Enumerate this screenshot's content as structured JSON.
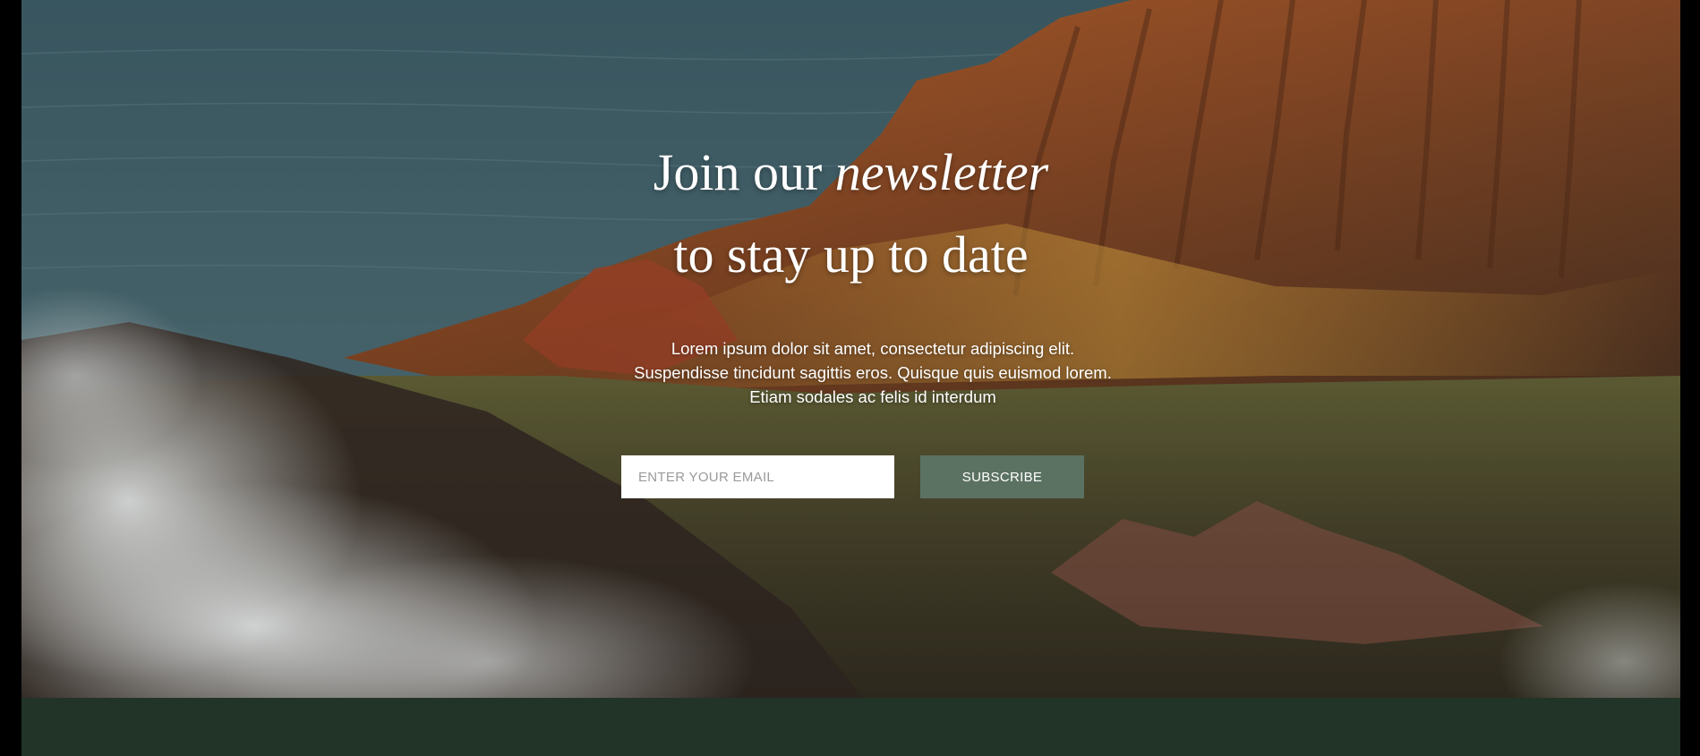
{
  "newsletter": {
    "heading_line1_prefix": "Join our ",
    "heading_line1_emphasis": "newsletter",
    "heading_line2": "to stay up to date",
    "description": "Lorem ipsum dolor sit amet, consectetur adipiscing elit. Suspendisse tincidunt sagittis eros. Quisque quis euismod lorem. Etiam sodales ac felis id interdum",
    "email_placeholder": "ENTER YOUR EMAIL",
    "email_value": "",
    "subscribe_label": "SUBSCRIBE"
  },
  "colors": {
    "subscribe_button": "#5b7262",
    "footer_band": "#223427",
    "text": "#ffffff"
  },
  "background_image": "coastal-mountain-cliffs-with-ocean-and-mist"
}
